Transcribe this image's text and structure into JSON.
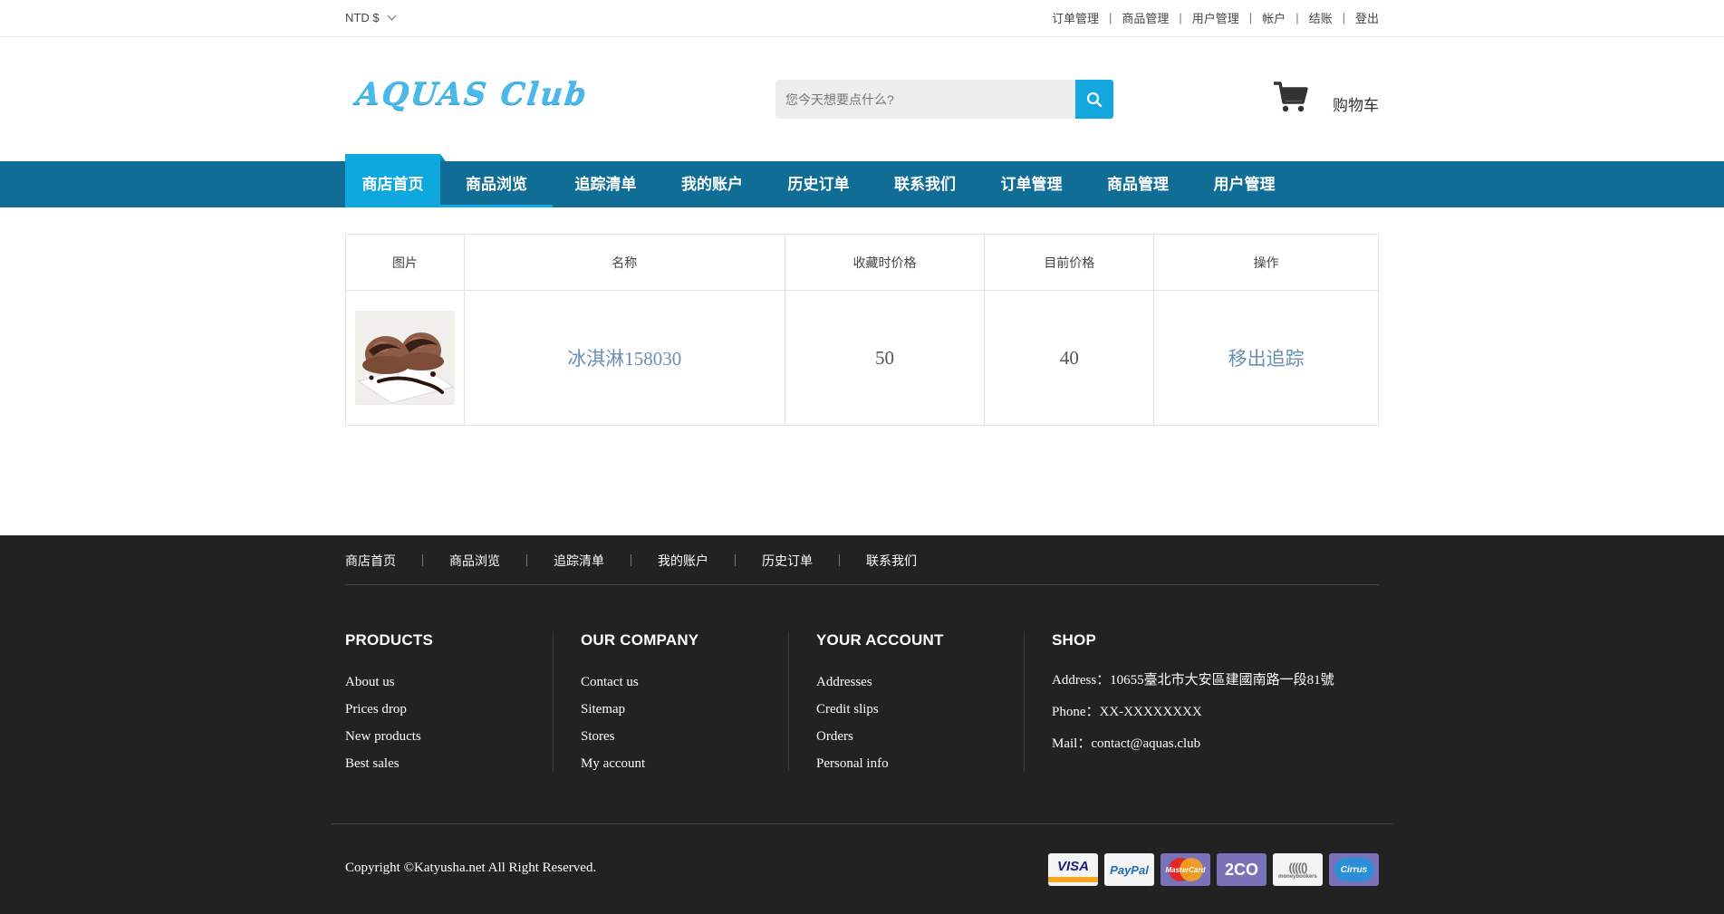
{
  "topbar": {
    "currency": "NTD $",
    "links": [
      "订单管理",
      "商品管理",
      "用户管理",
      "帐户",
      "结账",
      "登出"
    ]
  },
  "header": {
    "logo_text": "AQUAS Club",
    "search_placeholder": "您今天想要点什么?",
    "cart_label": "购物车"
  },
  "nav": {
    "items": [
      "商店首页",
      "商品浏览",
      "追踪清单",
      "我的账户",
      "历史订单",
      "联系我们",
      "订单管理",
      "商品管理",
      "用户管理"
    ],
    "active_index": 0
  },
  "table": {
    "headers": [
      "图片",
      "名称",
      "收藏时价格",
      "目前价格",
      "操作"
    ],
    "rows": [
      {
        "image": "chocolate-ice-cream",
        "name": "冰淇淋158030",
        "saved_price": "50",
        "current_price": "40",
        "action": "移出追踪"
      }
    ]
  },
  "footer": {
    "links": [
      "商店首页",
      "商品浏览",
      "追踪清单",
      "我的账户",
      "历史订单",
      "联系我们"
    ],
    "products": {
      "title": "PRODUCTS",
      "items": [
        "About us",
        "Prices drop",
        "New products",
        "Best sales"
      ]
    },
    "company": {
      "title": "OUR COMPANY",
      "items": [
        "Contact us",
        "Sitemap",
        "Stores",
        "My account"
      ]
    },
    "account": {
      "title": "YOUR ACCOUNT",
      "items": [
        "Addresses",
        "Credit slips",
        "Orders",
        "Personal info"
      ]
    },
    "shop": {
      "title": "SHOP",
      "address": "Address：10655臺北市大安區建國南路一段81號",
      "phone": "Phone：XX-XXXXXXXX",
      "mail": "Mail：contact@aquas.club"
    },
    "copyright": "Copyright ©Katyusha.net All Right Reserved.",
    "payments": [
      "VISA",
      "PayPal",
      "MasterCard",
      "2CO",
      "moneybookers",
      "Cirrus"
    ]
  },
  "colors": {
    "nav_bg": "#106e96",
    "nav_active": "#0ea8df",
    "search_button": "#13a7e0",
    "logo": "#4ab8ea",
    "link": "#6a8eb4",
    "footer_bg": "#222222"
  }
}
